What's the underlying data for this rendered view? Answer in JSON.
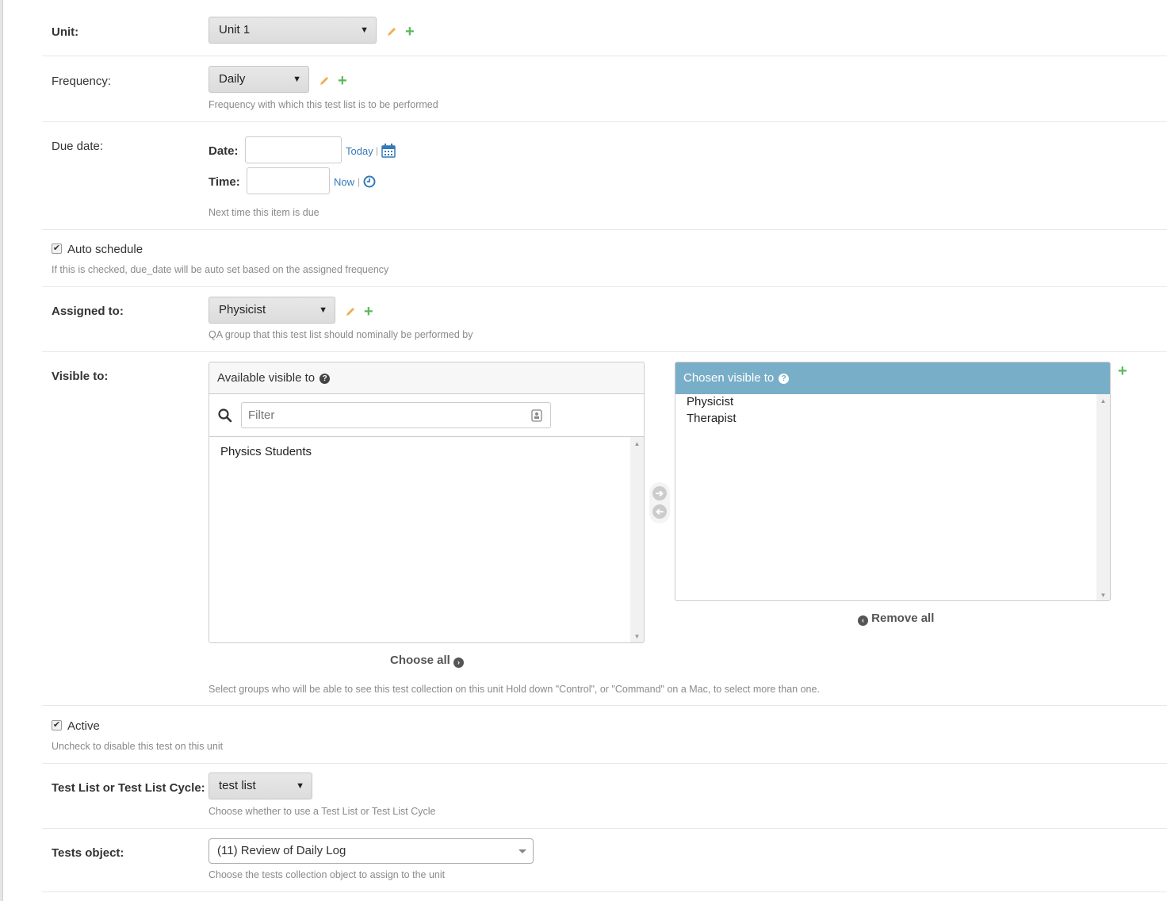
{
  "unit": {
    "label": "Unit:",
    "value": "Unit 1"
  },
  "frequency": {
    "label": "Frequency:",
    "value": "Daily",
    "help": "Frequency with which this test list is to be performed"
  },
  "due_date": {
    "label": "Due date:",
    "date_label": "Date:",
    "date_value": "",
    "today_link": "Today",
    "time_label": "Time:",
    "time_value": "",
    "now_link": "Now",
    "help": "Next time this item is due"
  },
  "auto_schedule": {
    "label": "Auto schedule",
    "checked": true,
    "help": "If this is checked, due_date will be auto set based on the assigned frequency"
  },
  "assigned_to": {
    "label": "Assigned to:",
    "value": "Physicist",
    "help": "QA group that this test list should nominally be performed by"
  },
  "visible_to": {
    "label": "Visible to:",
    "available_title": "Available visible to",
    "filter_placeholder": "Filter",
    "available_items": [
      "Physics Students"
    ],
    "chosen_title": "Chosen visible to",
    "chosen_items": [
      "Physicist",
      "Therapist"
    ],
    "choose_all": "Choose all",
    "remove_all": "Remove all",
    "help": "Select groups who will be able to see this test collection on this unit Hold down \"Control\", or \"Command\" on a Mac, to select more than one."
  },
  "active": {
    "label": "Active",
    "checked": true,
    "help": "Uncheck to disable this test on this unit"
  },
  "content_type": {
    "label": "Test List or Test List Cycle:",
    "value": "test list",
    "help": "Choose whether to use a Test List or Test List Cycle"
  },
  "tests_object": {
    "label": "Tests object:",
    "value": "(11) Review of Daily Log",
    "help": "Choose the tests collection object to assign to the unit"
  },
  "colors": {
    "chosen_header": "#79aec8",
    "add_icon": "#5cb85c",
    "edit_icon": "#f0ad4e",
    "link": "#337ab7"
  }
}
